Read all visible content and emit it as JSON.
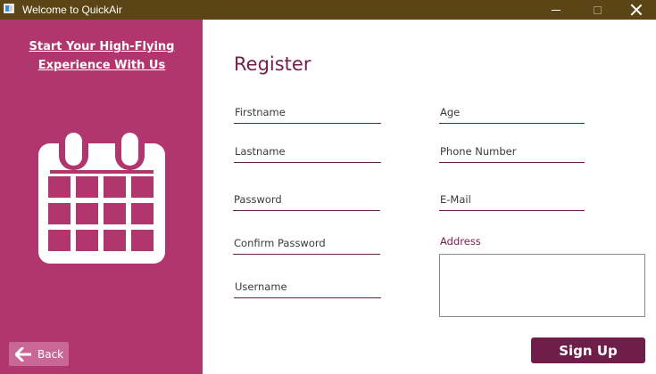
{
  "window": {
    "title": "Welcome to QuickAir",
    "icons": {
      "app": "app-window-icon",
      "minimize": "minimize-icon",
      "maximize": "maximize-icon",
      "close": "close-icon"
    }
  },
  "sidebar": {
    "tagline": "Start Your High-Flying Experience With Us",
    "illustration_icon": "calendar-icon",
    "back_label": "Back",
    "back_icon": "arrow-left-icon",
    "background": "#b0366d"
  },
  "form": {
    "heading": "Register",
    "fields": {
      "firstname": {
        "placeholder": "Firstname",
        "value": ""
      },
      "lastname": {
        "placeholder": "Lastname",
        "value": ""
      },
      "password": {
        "placeholder": "Password",
        "value": ""
      },
      "confirm_password": {
        "placeholder": "Confirm Password",
        "value": ""
      },
      "username": {
        "placeholder": "Username",
        "value": ""
      },
      "age": {
        "placeholder": "Age",
        "value": ""
      },
      "phone": {
        "placeholder": "Phone Number",
        "value": ""
      },
      "email": {
        "placeholder": "E-Mail",
        "value": ""
      }
    },
    "address_label": "Address",
    "address_value": "",
    "signup_label": "Sign Up"
  },
  "colors": {
    "titlebar": "#5b4516",
    "accent": "#6f1e4a",
    "sidebar": "#b0366d",
    "back_button": "#c96796"
  }
}
